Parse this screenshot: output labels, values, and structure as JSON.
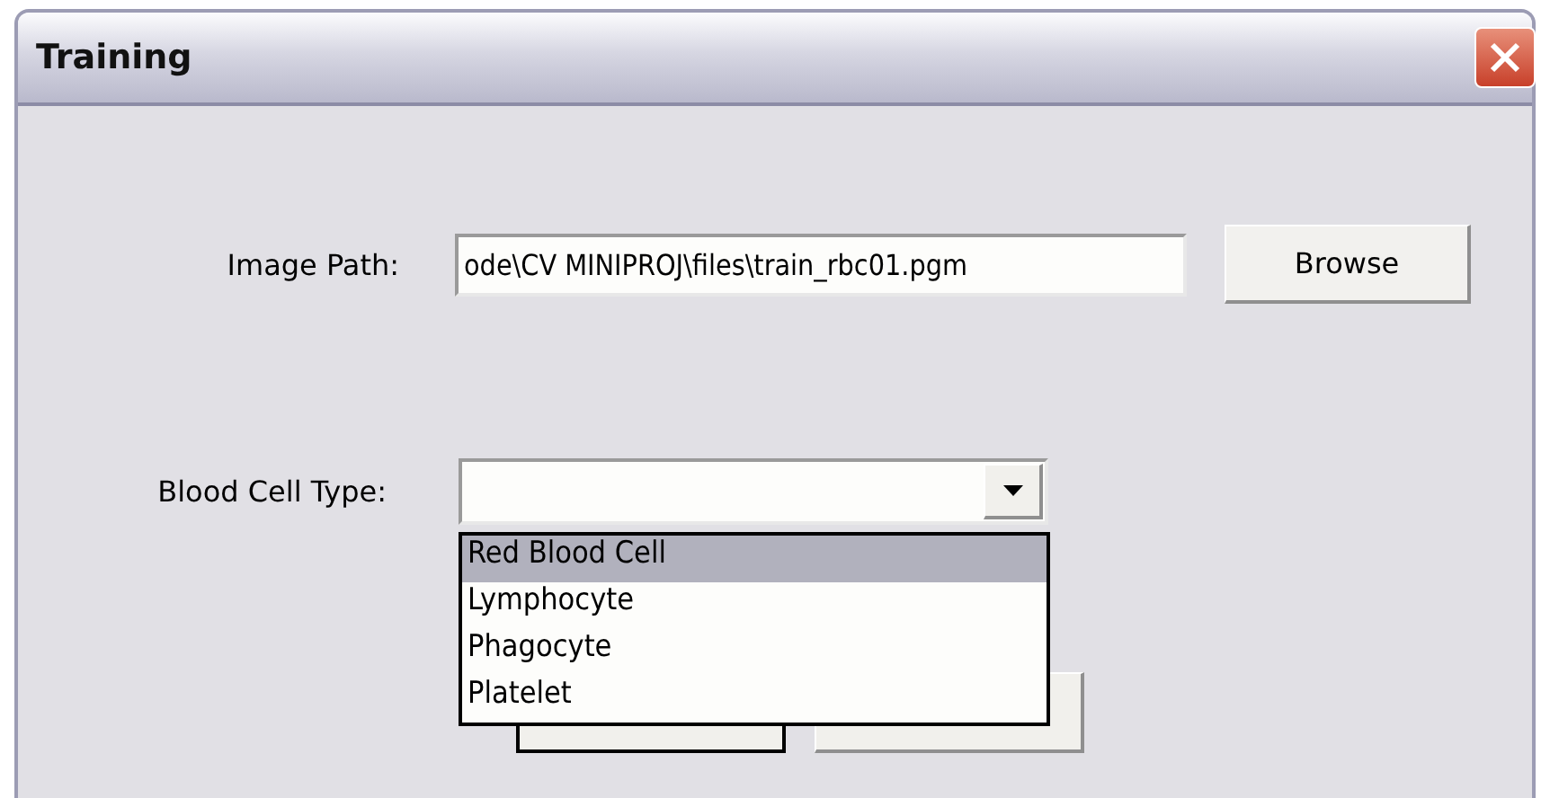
{
  "window": {
    "title": "Training"
  },
  "image_path": {
    "label": "Image Path:",
    "value": "ode\\CV MINIPROJ\\files\\train_rbc01.pgm"
  },
  "browse_button": {
    "label": "Browse"
  },
  "blood_cell_type": {
    "label": "Blood Cell Type:",
    "expanded": true,
    "options": [
      {
        "label": "Red Blood Cell",
        "selected": true
      },
      {
        "label": "Lymphocyte",
        "selected": false
      },
      {
        "label": "Phagocyte",
        "selected": false
      },
      {
        "label": "Platelet",
        "selected": false
      }
    ]
  }
}
